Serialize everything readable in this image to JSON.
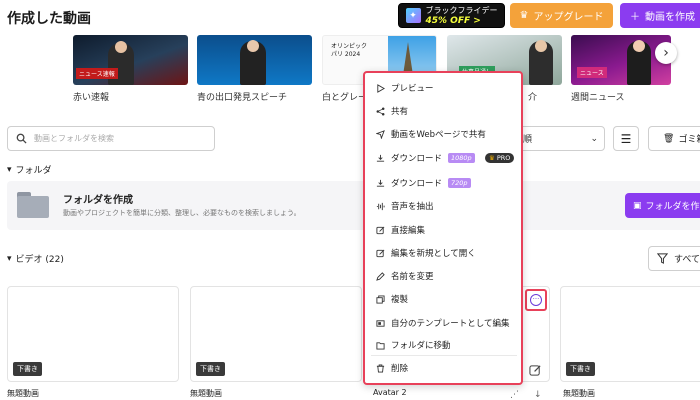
{
  "header": {
    "title": "作成した動画",
    "black_friday_line1": "ブラックフライデー",
    "black_friday_line2": "45% OFF >",
    "upgrade_label": "アップグレード",
    "create_label": "動画を作成"
  },
  "templates": [
    {
      "label": "赤い速報",
      "banner": "ニュース速報"
    },
    {
      "label": "青の出口発見スピーチ"
    },
    {
      "label": "白とグレー",
      "caption1": "オリンピック",
      "caption2": "パリ 2024"
    },
    {
      "label": "介",
      "tag": "仕事見通し"
    },
    {
      "label": "週間ニュース",
      "tag": "ニュース"
    }
  ],
  "search": {
    "placeholder": "動画とフォルダを検索"
  },
  "sort": {
    "value": "順"
  },
  "trash": {
    "label": "ゴミ箱"
  },
  "folders": {
    "section_label": "フォルダ",
    "create_title": "フォルダを作成",
    "create_desc": "動画やプロジェクトを簡単に分類、整理し、必要なものを検索しましょう。",
    "create_button": "フォルダを作成"
  },
  "videos": {
    "section_label": "ビデオ (22)",
    "filter_label": "すべて",
    "draft_label": "下書き",
    "items": [
      {
        "name": "無題動画"
      },
      {
        "name": "無題動画"
      },
      {
        "name": "Avatar 2"
      },
      {
        "name": "無題動画"
      }
    ]
  },
  "context_menu": {
    "items": [
      {
        "label": "プレビュー",
        "icon": "play-icon"
      },
      {
        "label": "共有",
        "icon": "share-icon"
      },
      {
        "label": "動画をWebページで共有",
        "icon": "send-icon"
      },
      {
        "label": "ダウンロード",
        "icon": "download-icon",
        "quality": "1080p",
        "badge": "PRO"
      },
      {
        "label": "ダウンロード",
        "icon": "download-icon",
        "quality": "720p"
      },
      {
        "label": "音声を抽出",
        "icon": "audio-wave-icon"
      },
      {
        "label": "直接編集",
        "icon": "edit-icon"
      },
      {
        "label": "編集を新規として開く",
        "icon": "edit-new-icon"
      },
      {
        "label": "名前を変更",
        "icon": "pen-icon"
      },
      {
        "label": "複製",
        "icon": "copy-icon"
      },
      {
        "label": "自分のテンプレートとして編集",
        "icon": "template-icon"
      },
      {
        "label": "フォルダに移動",
        "icon": "folder-move-icon"
      },
      {
        "label": "削除",
        "icon": "trash-icon"
      }
    ]
  },
  "colors": {
    "accent": "#8b3cf0",
    "upgrade": "#f4a23a",
    "highlight": "#e8415a"
  }
}
